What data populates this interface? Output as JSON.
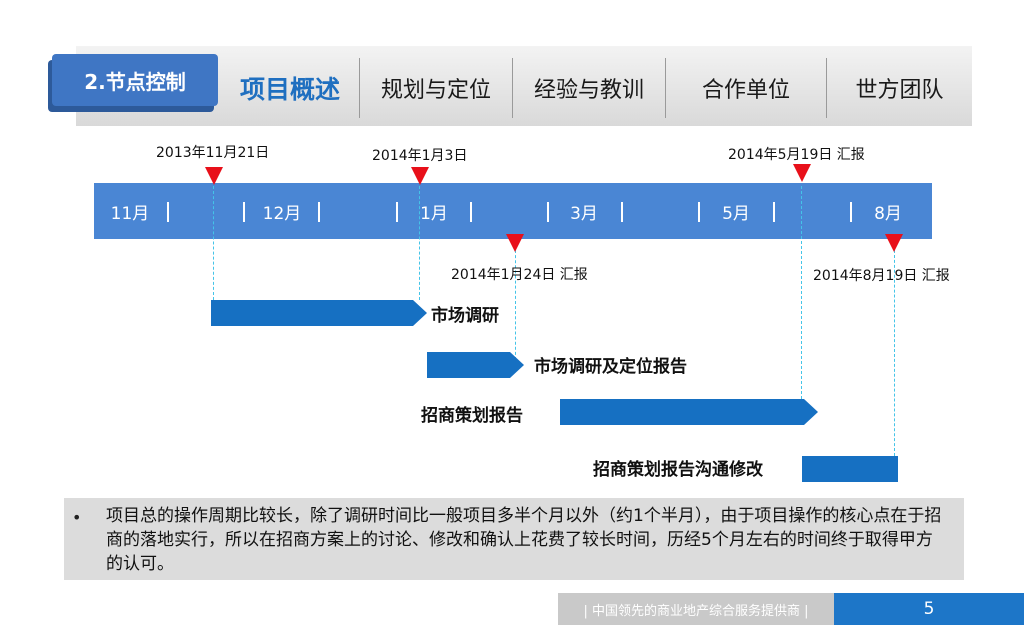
{
  "header": {
    "section_tag": "2.节点控制",
    "nav_items": [
      "项目概述",
      "规划与定位",
      "经验与教训",
      "合作单位",
      "世方团队"
    ]
  },
  "timeline": {
    "months": [
      "11月",
      "12月",
      "1月",
      "3月",
      "5月",
      "8月"
    ],
    "milestones_top": [
      "2013年11月21日",
      "2014年1月3日",
      "2014年5月19日  汇报"
    ],
    "milestones_bottom": [
      "2014年1月24日  汇报",
      "2014年8月19日  汇报"
    ]
  },
  "tasks": [
    "市场调研",
    "市场调研及定位报告",
    "招商策划报告",
    "招商策划报告沟通修改"
  ],
  "summary": {
    "bullet": "•",
    "text": "项目总的操作周期比较长，除了调研时间比一般项目多半个月以外（约1个半月），由于项目操作的核心点在于招商的落地实行，所以在招商方案上的讨论、修改和确认上花费了较长时间，历经5个月左右的时间终于取得甲方的认可。"
  },
  "footer": {
    "slogan": "| 中国领先的商业地产综合服务提供商 |",
    "page_number": "5"
  },
  "colors": {
    "accent": "#1670c2",
    "timeline": "#4a86d4",
    "marker": "#e8101a",
    "guide_line": "#44c4e8"
  }
}
